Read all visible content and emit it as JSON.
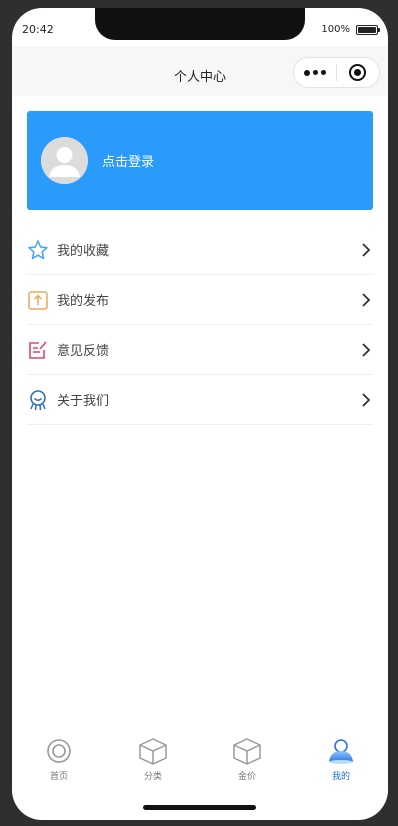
{
  "status_bar": {
    "time": "20:42",
    "battery": "100%"
  },
  "navbar": {
    "title": "个人中心"
  },
  "login_card": {
    "label": "点击登录",
    "color": "#2b9bfb"
  },
  "menu": {
    "items": [
      {
        "label": "我的收藏",
        "icon": "star-icon",
        "color": "#3ea7f0"
      },
      {
        "label": "我的发布",
        "icon": "upload-icon",
        "color": "#f0a657"
      },
      {
        "label": "意见反馈",
        "icon": "feedback-icon",
        "color": "#e2456e"
      },
      {
        "label": "关于我们",
        "icon": "about-icon",
        "color": "#2f6fb4"
      }
    ]
  },
  "tabbar": {
    "items": [
      {
        "label": "首页",
        "icon": "home-icon",
        "active": false
      },
      {
        "label": "分类",
        "icon": "box-icon",
        "active": false
      },
      {
        "label": "金价",
        "icon": "box-icon",
        "active": false
      },
      {
        "label": "我的",
        "icon": "user-icon",
        "active": true
      }
    ],
    "active_color": "#1e6fd0"
  }
}
